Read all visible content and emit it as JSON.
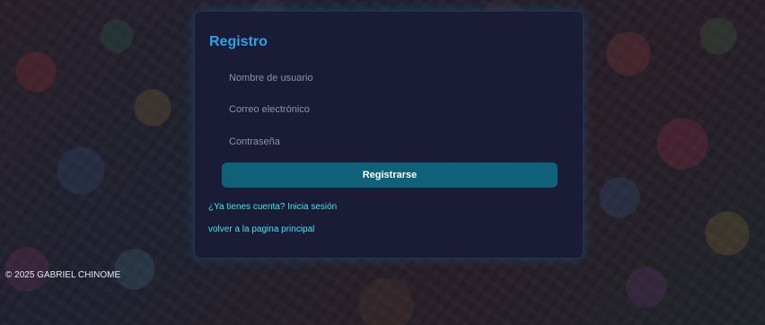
{
  "register_form": {
    "title": "Registro",
    "username_placeholder": "Nombre de usuario",
    "email_placeholder": "Correo electrónico",
    "password_placeholder": "Contraseña",
    "submit_label": "Registrarse",
    "login_link": "¿Ya tienes cuenta? Inicia sesión",
    "home_link": "volver a la pagina principal"
  },
  "footer": {
    "copyright": "© 2025 GABRIEL CHINOME"
  },
  "colors": {
    "title": "#2ba3e6",
    "button": "#0f6079",
    "link": "#44e4f2",
    "card_background": "#1a1b36"
  }
}
